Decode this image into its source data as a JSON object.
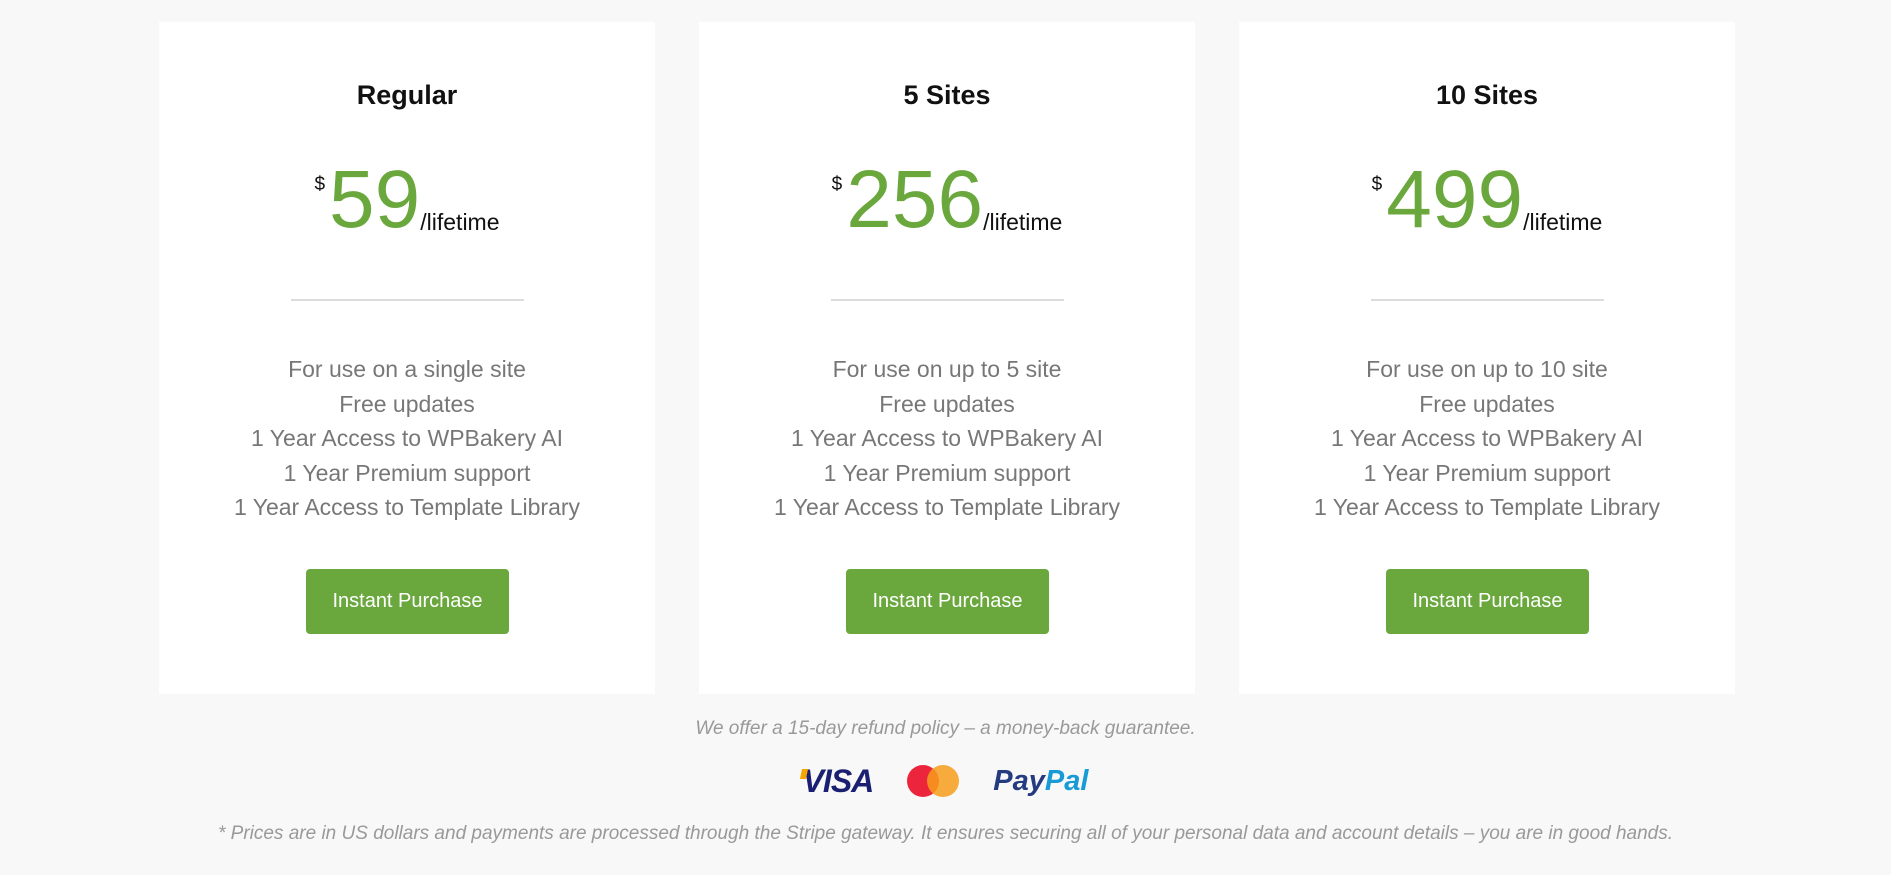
{
  "plans": [
    {
      "title": "Regular",
      "currency": "$",
      "amount": "59",
      "period": "/lifetime",
      "features": [
        "For use on a single site",
        "Free updates",
        "1 Year Access to WPBakery AI",
        "1 Year Premium support",
        "1 Year Access to Template Library"
      ],
      "button_label": "Instant Purchase"
    },
    {
      "title": "5 Sites",
      "currency": "$",
      "amount": "256",
      "period": "/lifetime",
      "features": [
        "For use on up to 5 site",
        "Free updates",
        "1 Year Access to WPBakery AI",
        "1 Year Premium support",
        "1 Year Access to Template Library"
      ],
      "button_label": "Instant Purchase"
    },
    {
      "title": "10 Sites",
      "currency": "$",
      "amount": "499",
      "period": "/lifetime",
      "features": [
        "For use on up to 10 site",
        "Free updates",
        "1 Year Access to WPBakery AI",
        "1 Year Premium support",
        "1 Year Access to Template Library"
      ],
      "button_label": "Instant Purchase"
    }
  ],
  "refund_note": "We offer a 15-day refund policy – a money-back guarantee.",
  "payment_logos": {
    "visa": "VISA",
    "mastercard_icon": "mastercard-icon",
    "paypal_pay": "Pay",
    "paypal_pal": "Pal"
  },
  "disclaimer": "* Prices are in US dollars and payments are processed through the Stripe gateway. It ensures securing all of your personal data and account details – you are in good hands.",
  "colors": {
    "accent": "#6aa83e",
    "background": "#f8f8f8",
    "card": "#ffffff",
    "muted_text": "#777777"
  }
}
